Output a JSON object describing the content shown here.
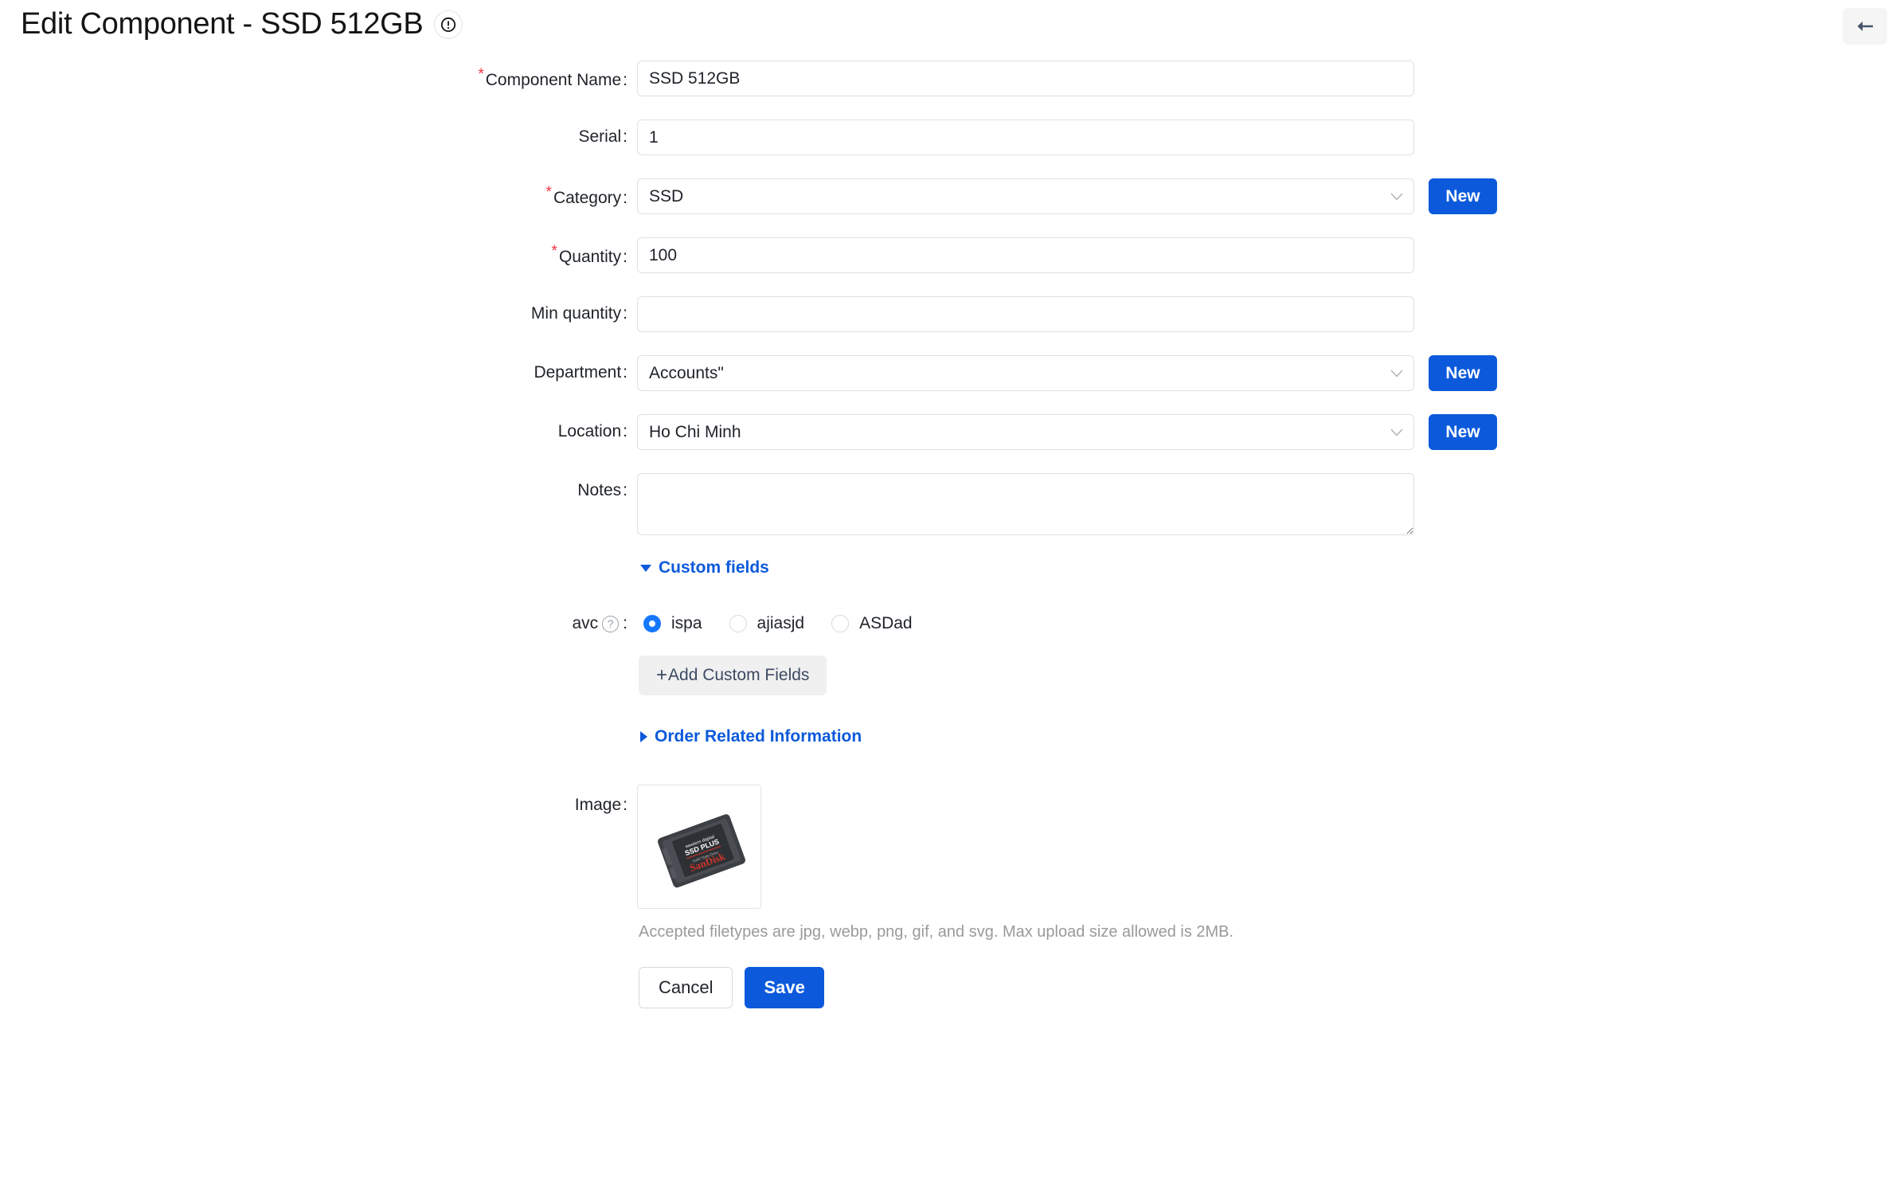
{
  "header": {
    "title": "Edit Component - SSD 512GB",
    "info_icon": "exclamation-circle-icon",
    "back_icon": "arrow-left-icon"
  },
  "form": {
    "fields": [
      {
        "label": "Component Name",
        "required": true,
        "type": "text",
        "value": "SSD 512GB",
        "placeholder": "",
        "has_new_button": false
      },
      {
        "label": "Serial",
        "required": false,
        "type": "text",
        "value": "1",
        "placeholder": "",
        "has_new_button": false
      },
      {
        "label": "Category",
        "required": true,
        "type": "select",
        "value": "SSD",
        "placeholder": "",
        "has_new_button": true
      },
      {
        "label": "Quantity",
        "required": true,
        "type": "text",
        "value": "100",
        "placeholder": "",
        "has_new_button": false
      },
      {
        "label": "Min quantity",
        "required": false,
        "type": "text",
        "value": "",
        "placeholder": "",
        "has_new_button": false
      },
      {
        "label": "Department",
        "required": false,
        "type": "select",
        "value": "Accounts\"",
        "placeholder": "",
        "has_new_button": true
      },
      {
        "label": "Location",
        "required": false,
        "type": "select",
        "value": "Ho Chi Minh",
        "placeholder": "",
        "has_new_button": true
      },
      {
        "label": "Notes",
        "required": false,
        "type": "textarea",
        "value": "",
        "placeholder": "",
        "has_new_button": false
      }
    ],
    "new_button_label": "New",
    "label_colon": ":"
  },
  "custom_fields_section": {
    "title": "Custom fields",
    "expanded": true,
    "toggle_icon": "triangle-down-icon",
    "field": {
      "label": "avc",
      "help_icon": "question-circle-icon",
      "help_glyph": "?",
      "type": "radio",
      "options": [
        {
          "label": "ispa",
          "selected": true
        },
        {
          "label": "ajiasjd",
          "selected": false
        },
        {
          "label": "ASDad",
          "selected": false
        }
      ]
    },
    "add_button_label": "Add Custom Fields",
    "add_button_plus": "+"
  },
  "order_section": {
    "title": "Order Related Information",
    "expanded": false,
    "toggle_icon": "triangle-right-icon"
  },
  "image_section": {
    "label": "Image",
    "thumbnail_alt": "SanDisk SSD PLUS solid state drive",
    "thumbnail_brand": "SanDisk",
    "thumbnail_model": "SSD PLUS",
    "hint": "Accepted filetypes are jpg, webp, png, gif, and svg. Max upload size allowed is 2MB."
  },
  "actions": {
    "cancel_label": "Cancel",
    "save_label": "Save"
  },
  "colors": {
    "primary_blue": "#0c5adb",
    "link_blue": "#0c5adb",
    "required_red": "#f5333f",
    "radio_blue": "#1677ff",
    "border_gray": "#e0e0e0",
    "hint_gray": "#9a9a9a",
    "button_gray": "#f0f0f1",
    "back_btn_gray": "#f5f5f5"
  }
}
